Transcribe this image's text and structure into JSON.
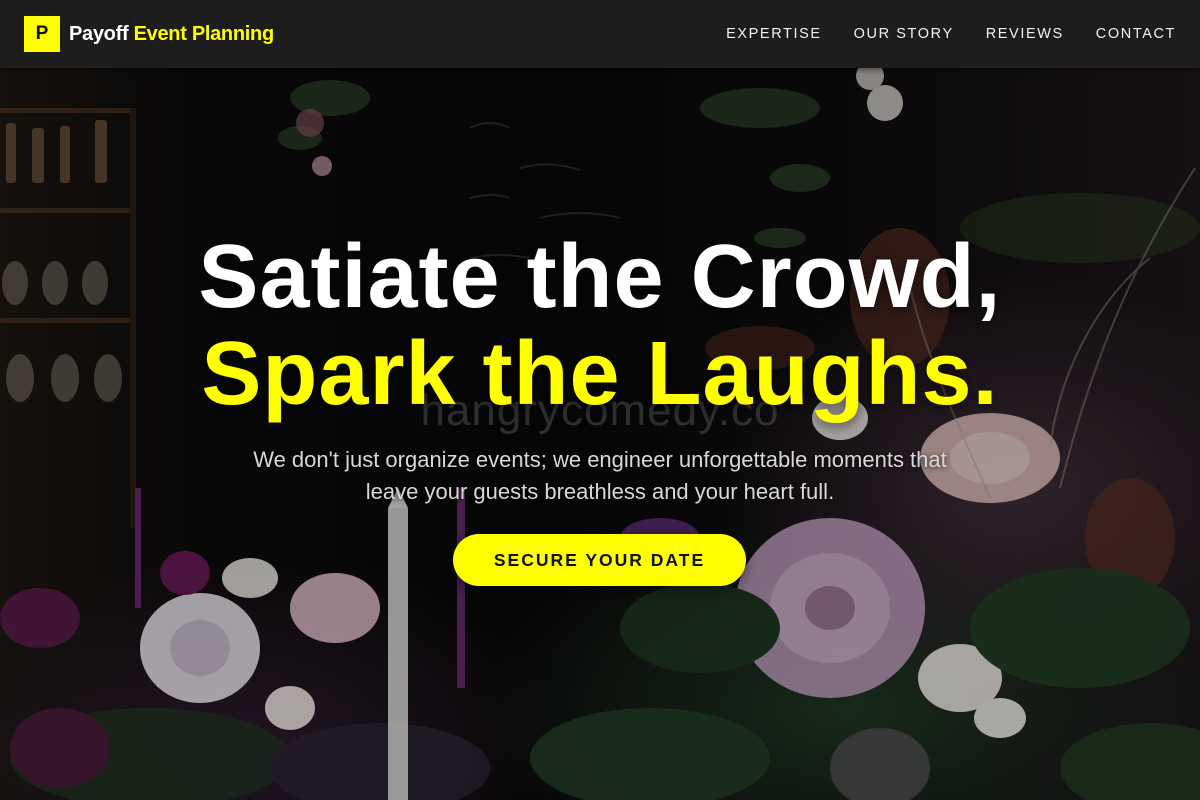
{
  "header": {
    "logo_letter": "P",
    "brand_word1": "Payoff",
    "brand_word2": "Event Planning",
    "nav": [
      {
        "label": "EXPERTISE"
      },
      {
        "label": "OUR STORY"
      },
      {
        "label": "REVIEWS"
      },
      {
        "label": "CONTACT"
      }
    ]
  },
  "hero": {
    "headline_line1": "Satiate the Crowd,",
    "headline_line2": "Spark the Laughs.",
    "watermark": "hangrycomedy.co",
    "subtitle": "We don't just organize events; we engineer unforgettable moments that leave your guests breathless and your heart full.",
    "cta_label": "SECURE YOUR DATE"
  },
  "colors": {
    "accent": "#ffff00",
    "header_bg": "#1d1d1d",
    "text_light": "#ffffff"
  }
}
